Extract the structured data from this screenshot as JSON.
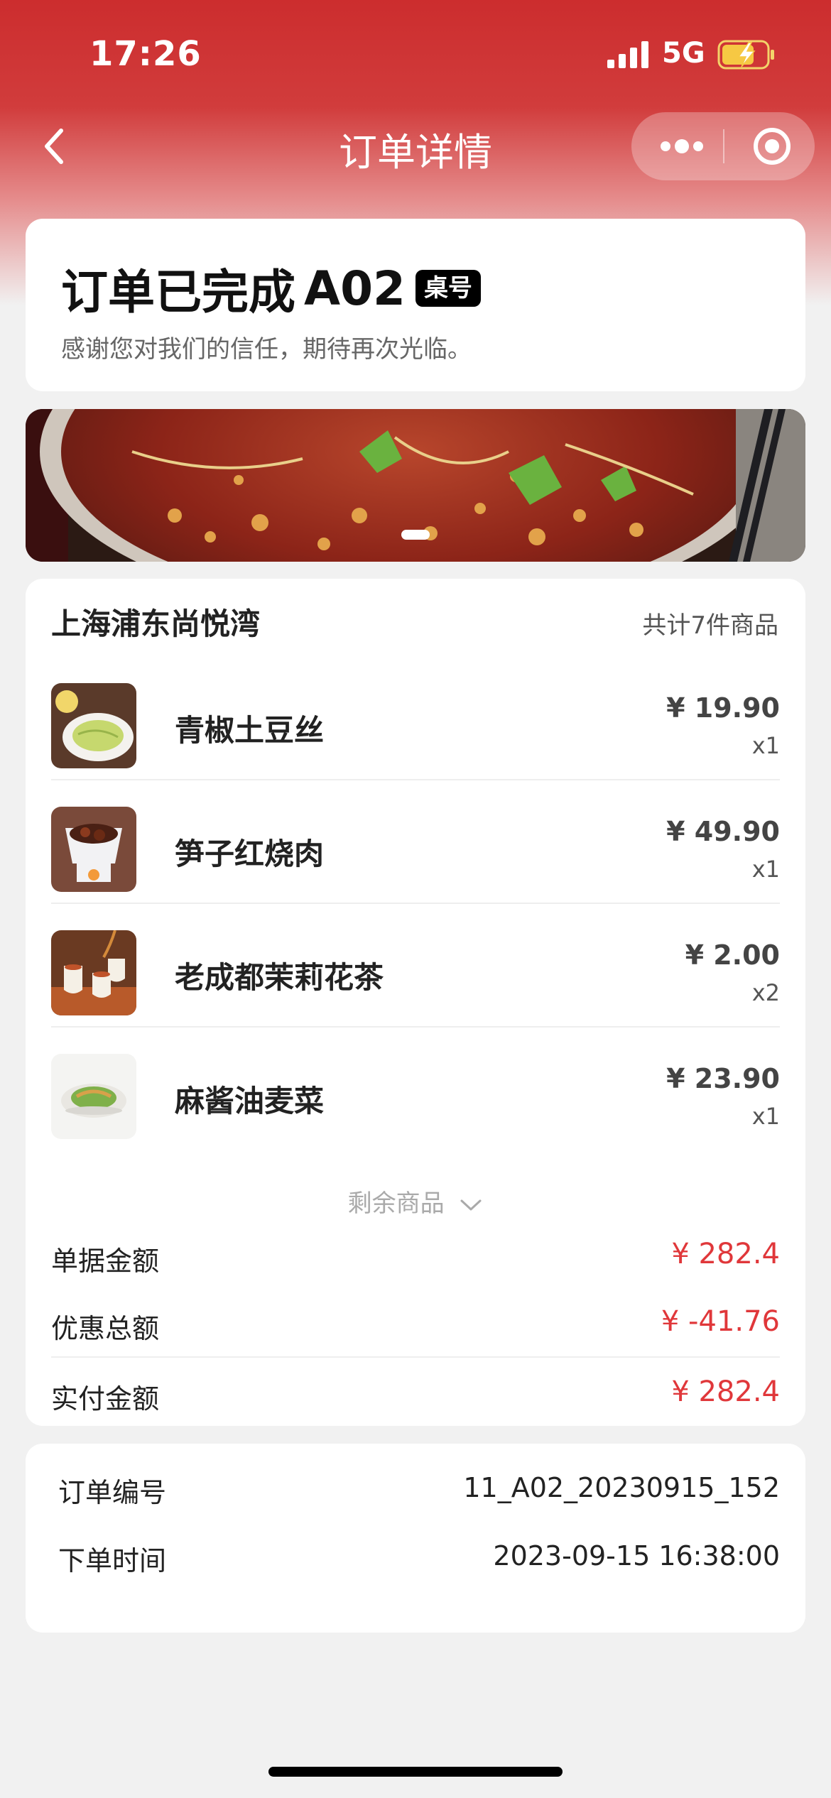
{
  "status_bar": {
    "time": "17:26",
    "network": "5G",
    "icons": [
      "signal-icon",
      "battery-charging-icon"
    ]
  },
  "nav": {
    "title": "订单详情",
    "icons": [
      "back-icon",
      "more-dots-icon",
      "close-target-icon"
    ]
  },
  "status_card": {
    "title": "订单已完成",
    "table_no": "A02",
    "table_badge": "桌号",
    "subtitle": "感谢您对我们的信任，期待再次光临。"
  },
  "banner": {
    "image": "spicy-fish-dish-banner",
    "slides": 1
  },
  "order": {
    "store_name": "上海浦东尚悦湾",
    "item_count": "共计7件商品",
    "items": [
      {
        "name": "青椒土豆丝",
        "price": "¥ 19.90",
        "qty": "x1",
        "thumb": "shredded-potato-thumb"
      },
      {
        "name": "笋子红烧肉",
        "price": "¥ 49.90",
        "qty": "x1",
        "thumb": "braised-pork-thumb"
      },
      {
        "name": "老成都茉莉花茶",
        "price": "¥ 2.00",
        "qty": "x2",
        "thumb": "jasmine-tea-thumb"
      },
      {
        "name": "麻酱油麦菜",
        "price": "¥ 23.90",
        "qty": "x1",
        "thumb": "lettuce-sesame-thumb"
      }
    ],
    "more_items_label": "剩余商品",
    "summary": [
      {
        "label": "单据金额",
        "value": "¥ 282.4"
      },
      {
        "label": "优惠总额",
        "value": "¥ -41.76"
      },
      {
        "label": "实付金额",
        "value": "¥ 282.4"
      }
    ]
  },
  "info": {
    "rows": [
      {
        "label": "订单编号",
        "value": "11_A02_20230915_152"
      },
      {
        "label": "下单时间",
        "value": "2023-09-15 16:38:00"
      }
    ]
  },
  "colors": {
    "brand_red": "#cc2d2e",
    "price_red": "#e0373a",
    "background": "#f1f1f1"
  }
}
